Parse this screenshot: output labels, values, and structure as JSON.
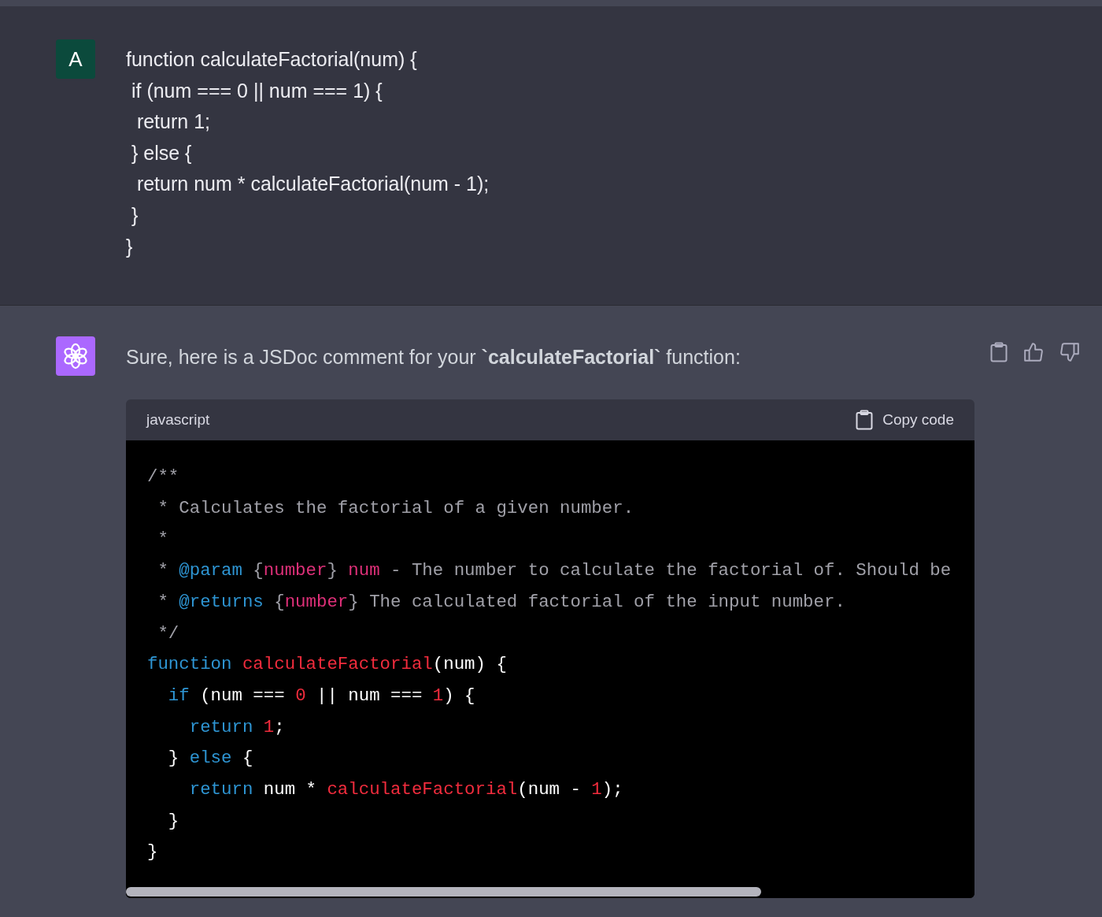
{
  "user_message": {
    "avatar": "A",
    "lines": [
      "function calculateFactorial(num) {",
      " if (num === 0 || num === 1) {",
      "  return 1;",
      " } else {",
      "  return num * calculateFactorial(num - 1);",
      " }",
      "}"
    ]
  },
  "assistant_message": {
    "intro": "Sure, here is a JSDoc comment for your **`calculateFactorial`** function:",
    "code_block": {
      "language": "javascript",
      "copy_label": "Copy code",
      "lines": [
        [
          {
            "kind": "comment",
            "text": "/**"
          }
        ],
        [
          {
            "kind": "comment",
            "text": " * Calculates the factorial of a given number."
          }
        ],
        [
          {
            "kind": "comment",
            "text": " *"
          }
        ],
        [
          {
            "kind": "comment",
            "text": " * "
          },
          {
            "kind": "tag",
            "text": "@param"
          },
          {
            "kind": "comment",
            "text": " {"
          },
          {
            "kind": "name",
            "text": "number"
          },
          {
            "kind": "comment",
            "text": "} "
          },
          {
            "kind": "name",
            "text": "num"
          },
          {
            "kind": "comment",
            "text": " - The number to calculate the factorial of. Should be"
          }
        ],
        [
          {
            "kind": "comment",
            "text": " * "
          },
          {
            "kind": "tag",
            "text": "@returns"
          },
          {
            "kind": "comment",
            "text": " {"
          },
          {
            "kind": "name",
            "text": "number"
          },
          {
            "kind": "comment",
            "text": "} The calculated factorial of the input number."
          }
        ],
        [
          {
            "kind": "comment",
            "text": " */"
          }
        ],
        [
          {
            "kind": "keyword",
            "text": "function "
          },
          {
            "kind": "name",
            "text": "calculateFactorial"
          },
          {
            "kind": "plain",
            "text": "(num) {"
          }
        ],
        [
          {
            "kind": "keyword",
            "text": "  if"
          },
          {
            "kind": "plain",
            "text": " (num === "
          },
          {
            "kind": "name",
            "text": "0"
          },
          {
            "kind": "plain",
            "text": " || num === "
          },
          {
            "kind": "name",
            "text": "1"
          },
          {
            "kind": "plain",
            "text": ") {"
          }
        ],
        [
          {
            "kind": "keyword",
            "text": "    return "
          },
          {
            "kind": "name",
            "text": "1"
          },
          {
            "kind": "plain",
            "text": ";"
          }
        ],
        [
          {
            "kind": "plain",
            "text": "  } "
          },
          {
            "kind": "keyword",
            "text": "else"
          },
          {
            "kind": "plain",
            "text": " {"
          }
        ],
        [
          {
            "kind": "keyword",
            "text": "    return"
          },
          {
            "kind": "plain",
            "text": " num * "
          },
          {
            "kind": "name",
            "text": "calculateFactorial"
          },
          {
            "kind": "plain",
            "text": "(num - "
          },
          {
            "kind": "name",
            "text": "1"
          },
          {
            "kind": "plain",
            "text": ");"
          }
        ],
        [
          {
            "kind": "plain",
            "text": "  }"
          }
        ],
        [
          {
            "kind": "plain",
            "text": "}"
          }
        ]
      ]
    }
  }
}
